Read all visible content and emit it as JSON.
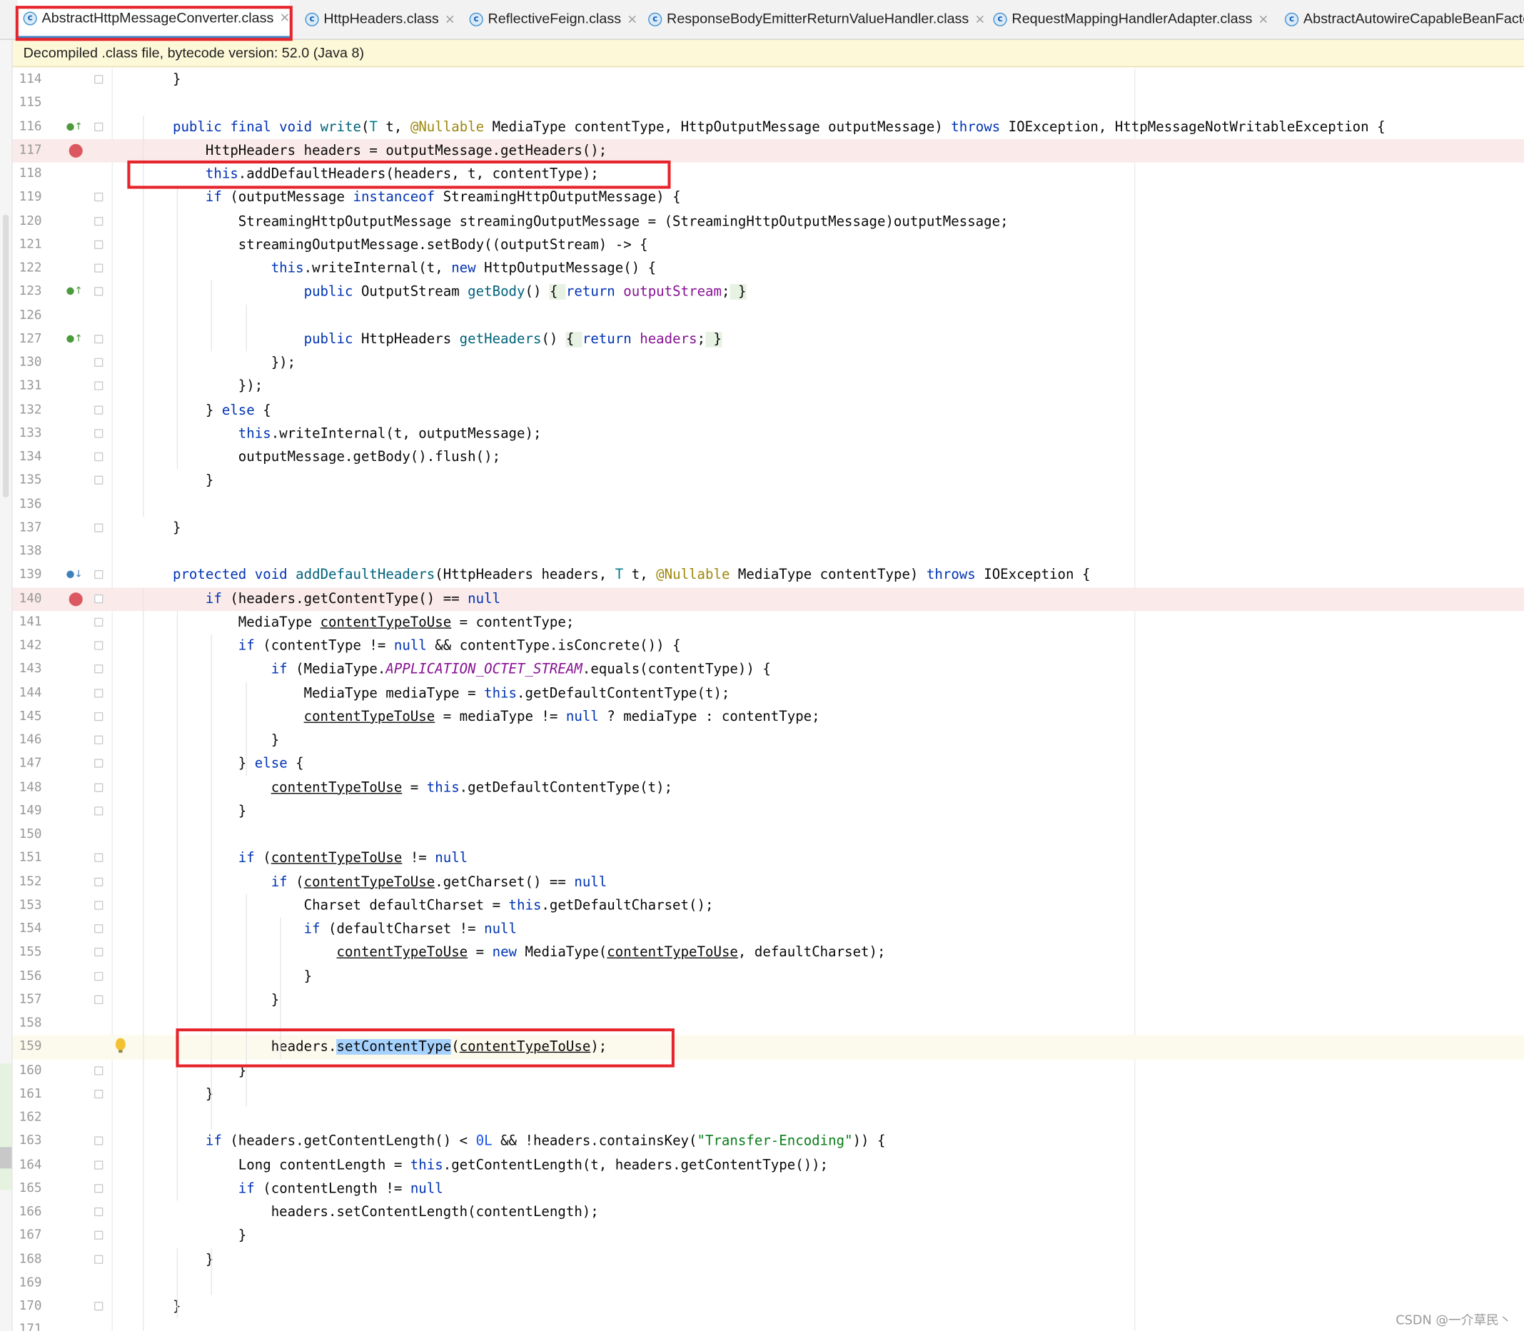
{
  "tabs": [
    {
      "label": "AbstractHttpMessageConverter.class",
      "icon": "class-icon",
      "active": true
    },
    {
      "label": "HttpHeaders.class",
      "icon": "class-icon",
      "active": false
    },
    {
      "label": "ReflectiveFeign.class",
      "icon": "class-icon",
      "active": false
    },
    {
      "label": "ResponseBodyEmitterReturnValueHandler.class",
      "icon": "class-icon",
      "active": false
    },
    {
      "label": "RequestMappingHandlerAdapter.class",
      "icon": "class-icon",
      "active": false
    },
    {
      "label": "AbstractAutowireCapableBeanFacto",
      "icon": "class-icon",
      "active": false
    }
  ],
  "tab_close_symbol": "×",
  "tab_icon_letter": "c",
  "banner": "Decompiled .class file, bytecode version: 52.0 (Java 8)",
  "lines": [
    {
      "n": "114",
      "tokens": [
        [
          "",
          "    }"
        ]
      ]
    },
    {
      "n": "115",
      "tokens": []
    },
    {
      "n": "116",
      "tokens": [
        [
          "",
          "    "
        ],
        [
          "k",
          "public final void "
        ],
        [
          "fn",
          "write"
        ],
        [
          "",
          "("
        ],
        [
          "tp",
          "T"
        ],
        [
          "",
          " t, "
        ],
        [
          "an",
          "@Nullable"
        ],
        [
          "",
          " MediaType contentType, HttpOutputMessage outputMessage) "
        ],
        [
          "k",
          "throws"
        ],
        [
          "",
          " IOException, HttpMessageNotWritableException {"
        ]
      ]
    },
    {
      "n": "117",
      "tokens": [
        [
          "",
          "        HttpHeaders headers = outputMessage.getHeaders();"
        ]
      ]
    },
    {
      "n": "118",
      "tokens": [
        [
          "",
          "        "
        ],
        [
          "k",
          "this"
        ],
        [
          "",
          ".addDefaultHeaders(headers, t, contentType);"
        ]
      ]
    },
    {
      "n": "119",
      "tokens": [
        [
          "",
          "        "
        ],
        [
          "k",
          "if"
        ],
        [
          "",
          " (outputMessage "
        ],
        [
          "k",
          "instanceof"
        ],
        [
          "",
          " StreamingHttpOutputMessage) {"
        ]
      ]
    },
    {
      "n": "120",
      "tokens": [
        [
          "",
          "            StreamingHttpOutputMessage streamingOutputMessage = (StreamingHttpOutputMessage)outputMessage;"
        ]
      ]
    },
    {
      "n": "121",
      "tokens": [
        [
          "",
          "            streamingOutputMessage.setBody((outputStream) -> {"
        ]
      ]
    },
    {
      "n": "122",
      "tokens": [
        [
          "",
          "                "
        ],
        [
          "k",
          "this"
        ],
        [
          "",
          ".writeInternal(t, "
        ],
        [
          "k",
          "new"
        ],
        [
          "",
          " HttpOutputMessage() {"
        ]
      ]
    },
    {
      "n": "123",
      "tokens": [
        [
          "",
          "                    "
        ],
        [
          "k",
          "public"
        ],
        [
          "",
          " OutputStream "
        ],
        [
          "fn",
          "getBody"
        ],
        [
          "",
          "() "
        ],
        [
          "foldtext",
          "{ "
        ],
        [
          "k",
          "return"
        ],
        [
          "",
          " "
        ],
        [
          "par",
          "outputStream"
        ],
        [
          "",
          ";"
        ],
        [
          "foldtext",
          " }"
        ]
      ]
    },
    {
      "n": "126",
      "tokens": []
    },
    {
      "n": "127",
      "tokens": [
        [
          "",
          "                    "
        ],
        [
          "k",
          "public"
        ],
        [
          "",
          " HttpHeaders "
        ],
        [
          "fn",
          "getHeaders"
        ],
        [
          "",
          "() "
        ],
        [
          "foldtext",
          "{ "
        ],
        [
          "k",
          "return"
        ],
        [
          "",
          " "
        ],
        [
          "par",
          "headers"
        ],
        [
          "",
          ";"
        ],
        [
          "foldtext",
          " }"
        ]
      ]
    },
    {
      "n": "130",
      "tokens": [
        [
          "",
          "                });"
        ]
      ]
    },
    {
      "n": "131",
      "tokens": [
        [
          "",
          "            });"
        ]
      ]
    },
    {
      "n": "132",
      "tokens": [
        [
          "",
          "        } "
        ],
        [
          "k",
          "else"
        ],
        [
          "",
          " {"
        ]
      ]
    },
    {
      "n": "133",
      "tokens": [
        [
          "",
          "            "
        ],
        [
          "k",
          "this"
        ],
        [
          "",
          ".writeInternal(t, outputMessage);"
        ]
      ]
    },
    {
      "n": "134",
      "tokens": [
        [
          "",
          "            outputMessage.getBody().flush();"
        ]
      ]
    },
    {
      "n": "135",
      "tokens": [
        [
          "",
          "        }"
        ]
      ]
    },
    {
      "n": "136",
      "tokens": []
    },
    {
      "n": "137",
      "tokens": [
        [
          "",
          "    }"
        ]
      ]
    },
    {
      "n": "138",
      "tokens": []
    },
    {
      "n": "139",
      "tokens": [
        [
          "",
          "    "
        ],
        [
          "k",
          "protected void "
        ],
        [
          "fn",
          "addDefaultHeaders"
        ],
        [
          "",
          "(HttpHeaders headers, "
        ],
        [
          "tp",
          "T"
        ],
        [
          "",
          " t, "
        ],
        [
          "an",
          "@Nullable"
        ],
        [
          "",
          " MediaType contentType) "
        ],
        [
          "k",
          "throws"
        ],
        [
          "",
          " IOException {"
        ]
      ]
    },
    {
      "n": "140",
      "tokens": [
        [
          "",
          "        "
        ],
        [
          "k",
          "if"
        ],
        [
          "",
          " (headers.getContentType() == "
        ],
        [
          "k",
          "null"
        ],
        [
          ") {"
        ]
      ]
    },
    {
      "n": "141",
      "tokens": [
        [
          "",
          "            MediaType "
        ],
        [
          "lv",
          "contentTypeToUse"
        ],
        [
          "",
          " = contentType;"
        ]
      ]
    },
    {
      "n": "142",
      "tokens": [
        [
          "",
          "            "
        ],
        [
          "k",
          "if"
        ],
        [
          "",
          " (contentType != "
        ],
        [
          "k",
          "null"
        ],
        [
          "",
          " && contentType.isConcrete()) {"
        ]
      ]
    },
    {
      "n": "143",
      "tokens": [
        [
          "",
          "                "
        ],
        [
          "k",
          "if"
        ],
        [
          "",
          " (MediaType."
        ],
        [
          "sfi",
          "APPLICATION_OCTET_STREAM"
        ],
        [
          "",
          ".equals(contentType)) {"
        ]
      ]
    },
    {
      "n": "144",
      "tokens": [
        [
          "",
          "                    MediaType mediaType = "
        ],
        [
          "k",
          "this"
        ],
        [
          "",
          ".getDefaultContentType(t);"
        ]
      ]
    },
    {
      "n": "145",
      "tokens": [
        [
          "",
          "                    "
        ],
        [
          "lv",
          "contentTypeToUse"
        ],
        [
          "",
          " = mediaType != "
        ],
        [
          "k",
          "null"
        ],
        [
          "",
          " ? mediaType : contentType;"
        ]
      ]
    },
    {
      "n": "146",
      "tokens": [
        [
          "",
          "                }"
        ]
      ]
    },
    {
      "n": "147",
      "tokens": [
        [
          "",
          "            } "
        ],
        [
          "k",
          "else"
        ],
        [
          "",
          " {"
        ]
      ]
    },
    {
      "n": "148",
      "tokens": [
        [
          "",
          "                "
        ],
        [
          "lv",
          "contentTypeToUse"
        ],
        [
          "",
          " = "
        ],
        [
          "k",
          "this"
        ],
        [
          "",
          ".getDefaultContentType(t);"
        ]
      ]
    },
    {
      "n": "149",
      "tokens": [
        [
          "",
          "            }"
        ]
      ]
    },
    {
      "n": "150",
      "tokens": []
    },
    {
      "n": "151",
      "tokens": [
        [
          "",
          "            "
        ],
        [
          "k",
          "if"
        ],
        [
          "",
          " ("
        ],
        [
          "lv",
          "contentTypeToUse"
        ],
        [
          "",
          " != "
        ],
        [
          "k",
          "null"
        ],
        [
          ") {"
        ]
      ]
    },
    {
      "n": "152",
      "tokens": [
        [
          "",
          "                "
        ],
        [
          "k",
          "if"
        ],
        [
          "",
          " ("
        ],
        [
          "lv",
          "contentTypeToUse"
        ],
        [
          "",
          ".getCharset() == "
        ],
        [
          "k",
          "null"
        ],
        [
          ") {"
        ]
      ]
    },
    {
      "n": "153",
      "tokens": [
        [
          "",
          "                    Charset defaultCharset = "
        ],
        [
          "k",
          "this"
        ],
        [
          "",
          ".getDefaultCharset();"
        ]
      ]
    },
    {
      "n": "154",
      "tokens": [
        [
          "",
          "                    "
        ],
        [
          "k",
          "if"
        ],
        [
          "",
          " (defaultCharset != "
        ],
        [
          "k",
          "null"
        ],
        [
          ") {"
        ]
      ]
    },
    {
      "n": "155",
      "tokens": [
        [
          "",
          "                        "
        ],
        [
          "lv",
          "contentTypeToUse"
        ],
        [
          "",
          " = "
        ],
        [
          "k",
          "new"
        ],
        [
          "",
          " MediaType("
        ],
        [
          "lv",
          "contentTypeToUse"
        ],
        [
          "",
          ", defaultCharset);"
        ]
      ]
    },
    {
      "n": "156",
      "tokens": [
        [
          "",
          "                    }"
        ]
      ]
    },
    {
      "n": "157",
      "tokens": [
        [
          "",
          "                }"
        ]
      ]
    },
    {
      "n": "158",
      "tokens": []
    },
    {
      "n": "159",
      "tokens": [
        [
          "",
          "                headers."
        ],
        [
          "sel",
          "setContentType"
        ],
        [
          "",
          "("
        ],
        [
          "lv",
          "contentTypeToUse"
        ],
        [
          "",
          ");"
        ]
      ]
    },
    {
      "n": "160",
      "tokens": [
        [
          "",
          "            }"
        ]
      ]
    },
    {
      "n": "161",
      "tokens": [
        [
          "",
          "        }"
        ]
      ]
    },
    {
      "n": "162",
      "tokens": []
    },
    {
      "n": "163",
      "tokens": [
        [
          "",
          "        "
        ],
        [
          "k",
          "if"
        ],
        [
          "",
          " (headers.getContentLength() < "
        ],
        [
          "num",
          "0L"
        ],
        [
          "",
          " && !headers.containsKey("
        ],
        [
          "st",
          "\"Transfer-Encoding\""
        ],
        [
          "",
          "))"
        ],
        [
          "",
          " {"
        ]
      ]
    },
    {
      "n": "164",
      "tokens": [
        [
          "",
          "            Long contentLength = "
        ],
        [
          "k",
          "this"
        ],
        [
          "",
          ".getContentLength(t, headers.getContentType());"
        ]
      ]
    },
    {
      "n": "165",
      "tokens": [
        [
          "",
          "            "
        ],
        [
          "k",
          "if"
        ],
        [
          "",
          " (contentLength != "
        ],
        [
          "k",
          "null"
        ],
        [
          ") {"
        ]
      ]
    },
    {
      "n": "166",
      "tokens": [
        [
          "",
          "                headers.setContentLength(contentLength);"
        ]
      ]
    },
    {
      "n": "167",
      "tokens": [
        [
          "",
          "            }"
        ]
      ]
    },
    {
      "n": "168",
      "tokens": [
        [
          "",
          "        }"
        ]
      ]
    },
    {
      "n": "169",
      "tokens": []
    },
    {
      "n": "170",
      "tokens": [
        [
          "",
          "    }"
        ]
      ]
    },
    {
      "n": "171",
      "tokens": []
    }
  ],
  "watermark": "CSDN @一介草民丶"
}
